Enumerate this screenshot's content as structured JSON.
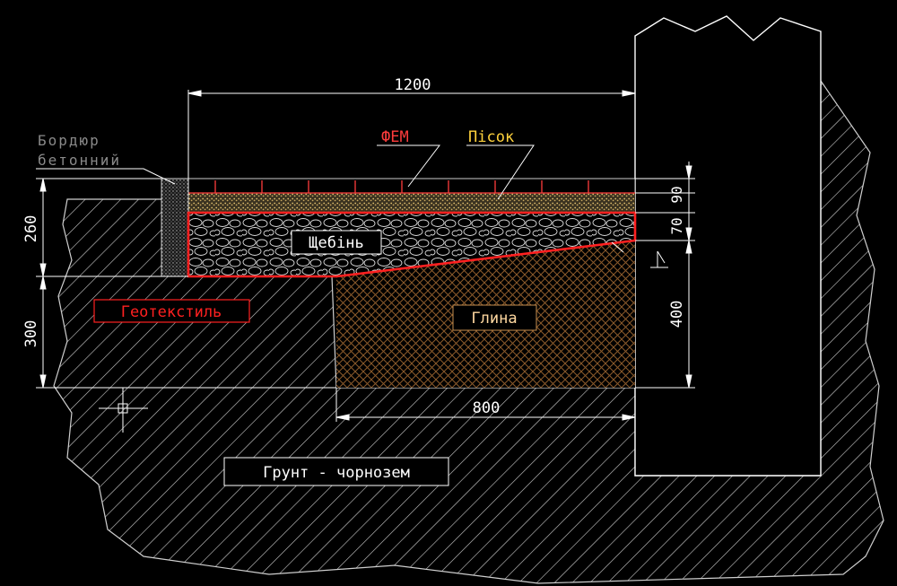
{
  "dimensions": {
    "total_width": "1200",
    "clay_width": "800",
    "left_upper": "260",
    "left_lower": "300",
    "right_top": "90",
    "right_mid": "70",
    "right_lower": "400"
  },
  "labels": {
    "curb_line1": "Бордюр",
    "curb_line2": "бетонний",
    "fem": "ФЕМ",
    "sand": "Пісок",
    "gravel": "Щебінь",
    "geotextile": "Геотекстиль",
    "clay": "Глина",
    "soil": "Грунт - чорнозем"
  },
  "colors": {
    "background": "#000000",
    "lines": "#ffffff",
    "geotextile_red": "#ff2020",
    "fem_red": "#ff3c3c",
    "sand_yellow": "#ffd23c",
    "clay_brown": "#8b5a2b",
    "sand_fill": "#a08a55"
  }
}
